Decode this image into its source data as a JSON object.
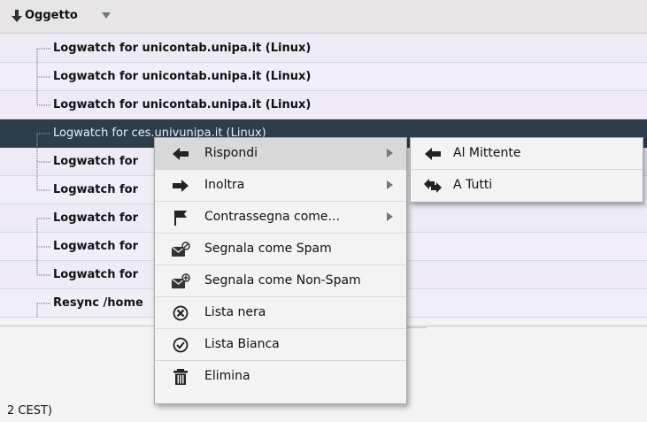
{
  "header": {
    "column_title": "Oggetto"
  },
  "rows": [
    {
      "subject": "Logwatch for unicontab.unipa.it (Linux)",
      "tree": "start"
    },
    {
      "subject": "Logwatch for unicontab.unipa.it (Linux)",
      "tree": "mid"
    },
    {
      "subject": "Logwatch for unicontab.unipa.it (Linux)",
      "tree": "end"
    },
    {
      "subject": "Logwatch for ces.univunipa.it (Linux)",
      "tree": "start",
      "selected": true
    },
    {
      "subject": "Logwatch for",
      "tree": "mid"
    },
    {
      "subject": "Logwatch for",
      "tree": "end"
    },
    {
      "subject": "Logwatch for",
      "tree": "start"
    },
    {
      "subject": "Logwatch for",
      "tree": "mid"
    },
    {
      "subject": "Logwatch for",
      "tree": "end"
    },
    {
      "subject": "Resync /home",
      "tree": "start"
    }
  ],
  "preview": {
    "footer_text": "2 CEST)"
  },
  "context_menu": {
    "items": [
      {
        "label": "Rispondi",
        "icon": "arrow-left-icon",
        "submenu": true
      },
      {
        "label": "Inoltra",
        "icon": "arrow-right-icon",
        "submenu": true
      },
      {
        "label": "Contrassegna come...",
        "icon": "flag-icon",
        "submenu": true
      },
      {
        "label": "Segnala come Spam",
        "icon": "mail-spam-icon"
      },
      {
        "label": "Segnala come Non-Spam",
        "icon": "mail-notspam-icon"
      },
      {
        "label": "Lista nera",
        "icon": "blacklist-icon"
      },
      {
        "label": "Lista Bianca",
        "icon": "whitelist-icon"
      },
      {
        "label": "Elimina",
        "icon": "trash-icon"
      }
    ]
  },
  "submenu": {
    "items": [
      {
        "label": "Al Mittente",
        "icon": "reply-sender-icon"
      },
      {
        "label": "A Tutti",
        "icon": "reply-all-icon"
      }
    ]
  },
  "colors": {
    "selected_row": "#2c3e4c",
    "row_bg": "#eeebf7",
    "menu_bg": "#f3f3f3"
  }
}
